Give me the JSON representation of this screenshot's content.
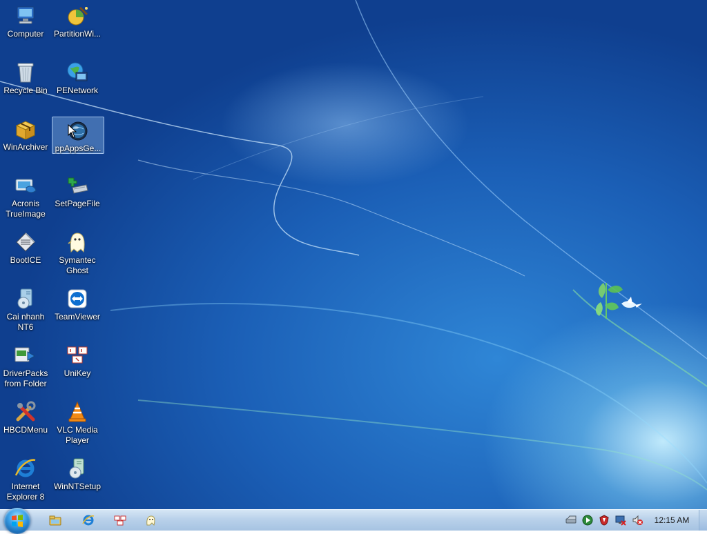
{
  "desktop": {
    "icons": [
      {
        "label": "Computer",
        "icon": "computer-icon"
      },
      {
        "label": "PartitionWi...",
        "icon": "partition-wizard-icon"
      },
      {
        "label": "Recycle Bin",
        "icon": "recycle-bin-icon"
      },
      {
        "label": "PENetwork",
        "icon": "network-globe-icon"
      },
      {
        "label": "WinArchiver",
        "icon": "archive-box-icon"
      },
      {
        "label": "ppAppsGe...",
        "icon": "globe-app-icon",
        "selected": true
      },
      {
        "label": "Acronis TrueImage",
        "icon": "acronis-icon"
      },
      {
        "label": "SetPageFile",
        "icon": "pagefile-icon"
      },
      {
        "label": "BootICE",
        "icon": "bootice-icon"
      },
      {
        "label": "Symantec Ghost",
        "icon": "ghost-icon"
      },
      {
        "label": "Cai nhanh NT6",
        "icon": "installer-disc-icon"
      },
      {
        "label": "TeamViewer",
        "icon": "teamviewer-icon"
      },
      {
        "label": "DriverPacks from Folder",
        "icon": "driverpacks-icon"
      },
      {
        "label": "UniKey",
        "icon": "unikey-icon"
      },
      {
        "label": "HBCDMenu",
        "icon": "tools-icon"
      },
      {
        "label": "VLC Media Player",
        "icon": "vlc-cone-icon"
      },
      {
        "label": "Internet Explorer 8",
        "icon": "internet-explorer-icon"
      },
      {
        "label": "WinNTSetup",
        "icon": "winntsetup-icon"
      }
    ]
  },
  "taskbar": {
    "start": "windows-start-orb-icon",
    "pinned": [
      "file-explorer-icon",
      "internet-explorer-icon",
      "unikey-icon",
      "symantec-ghost-icon"
    ],
    "tray": [
      "drive-icon",
      "media-play-icon",
      "shield-icon",
      "network-monitor-icon",
      "volume-muted-icon"
    ],
    "clock": "12:15 AM"
  },
  "colors": {
    "desktop_blue": "#1b5fb6",
    "taskbar": "#b9d1ea",
    "label_text": "#ffffff"
  }
}
